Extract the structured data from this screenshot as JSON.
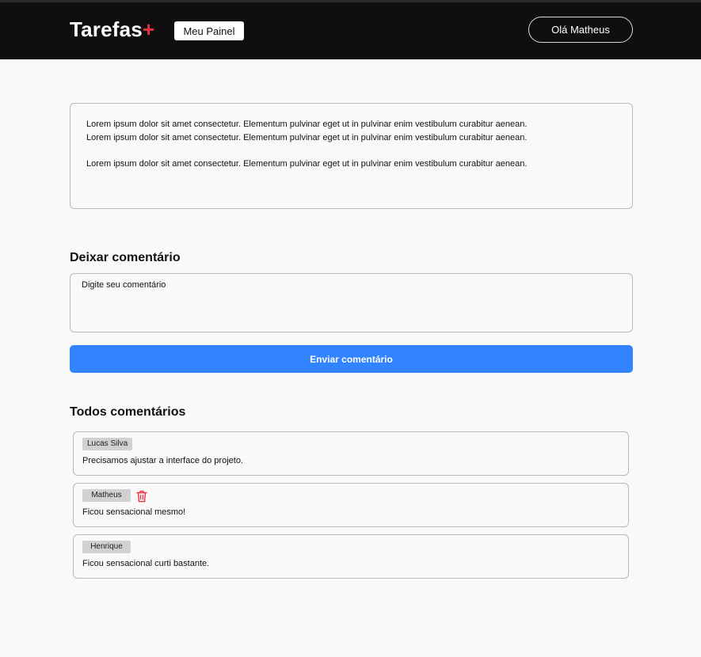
{
  "header": {
    "logo_text": "Tarefas",
    "logo_plus": "+",
    "panel_button": "Meu Painel",
    "user_button": "Olá Matheus"
  },
  "task": {
    "lines": [
      "Lorem ipsum dolor sit amet consectetur. Elementum pulvinar eget ut in pulvinar enim vestibulum curabitur aenean.",
      "Lorem ipsum dolor sit amet consectetur. Elementum pulvinar eget ut in pulvinar enim vestibulum curabitur aenean.",
      "Lorem ipsum dolor sit amet consectetur. Elementum pulvinar eget ut in pulvinar enim vestibulum curabitur aenean."
    ]
  },
  "comment_form": {
    "title": "Deixar comentário",
    "placeholder": "Digite seu comentário",
    "value": "",
    "submit_label": "Enviar comentário"
  },
  "comments_section": {
    "title": "Todos comentários",
    "items": [
      {
        "author": "Lucas Silva",
        "text": "Precisamos ajustar a interface do projeto.",
        "can_delete": false
      },
      {
        "author": "Matheus",
        "text": "Ficou sensacional mesmo!",
        "can_delete": true
      },
      {
        "author": "Henrique",
        "text": "Ficou sensacional curti bastante.",
        "can_delete": false
      }
    ]
  },
  "colors": {
    "header_bg": "#0f0f0f",
    "accent_plus": "#ea3140",
    "primary_button": "#3183ff",
    "delete_icon": "#ea3140",
    "tag_bg": "#d1d1d1"
  },
  "icons": {
    "delete": "trash-icon"
  }
}
